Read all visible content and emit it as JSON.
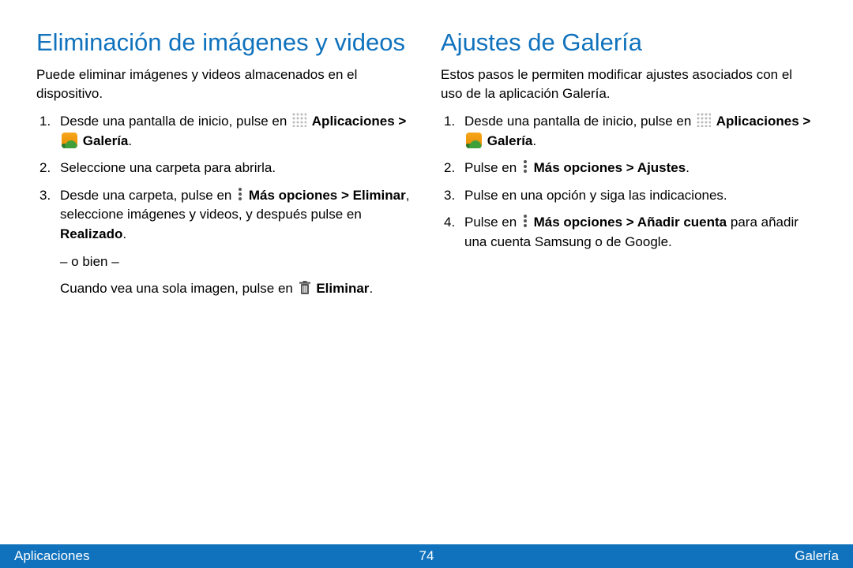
{
  "left": {
    "heading": "Eliminación de imágenes y videos",
    "intro": "Puede eliminar imágenes y videos almacenados en el dispositivo.",
    "step1_pre": "Desde una pantalla de inicio, pulse en ",
    "apps_label": "Aplicaciones > ",
    "gallery_label": " Galería",
    "step2": "Seleccione una carpeta para abrirla.",
    "step3_pre": "Desde una carpeta, pulse en ",
    "more_delete": "Más opciones > Eliminar",
    "step3_mid": ", seleccione imágenes y videos, y después pulse en ",
    "done": "Realizado",
    "or": "– o bien –",
    "single_pre": "Cuando vea una sola imagen, pulse en ",
    "delete": "Eliminar"
  },
  "right": {
    "heading": "Ajustes de Galería",
    "intro": "Estos pasos le permiten modificar ajustes asociados con el uso de la aplicación Galería.",
    "step1_pre": "Desde una pantalla de inicio, pulse en ",
    "apps_label": "Aplicaciones > ",
    "gallery_label": " Galería",
    "step2_pre": "Pulse en ",
    "more_settings": "Más opciones > Ajustes",
    "step3": "Pulse en una opción y siga las indicaciones.",
    "step4_pre": "Pulse en ",
    "more_add": "Más opciones > Añadir cuenta",
    "step4_post": " para añadir una cuenta Samsung o de Google."
  },
  "footer": {
    "left": "Aplicaciones",
    "center": "74",
    "right": "Galería"
  }
}
